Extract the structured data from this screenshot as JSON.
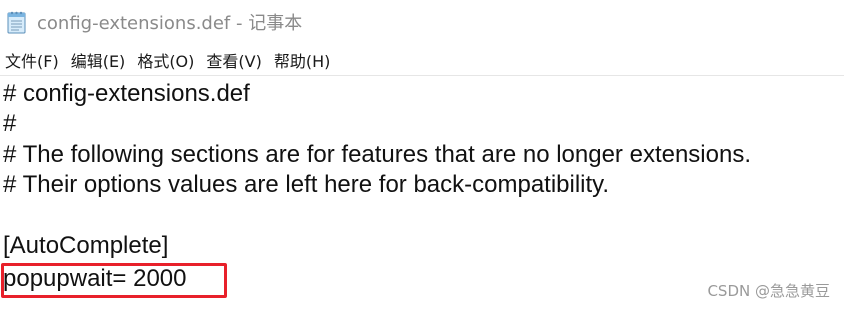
{
  "window": {
    "title": "config-extensions.def - 记事本",
    "icon": "notepad-icon"
  },
  "menu": {
    "items": [
      {
        "label": "文件(F)"
      },
      {
        "label": "编辑(E)"
      },
      {
        "label": "格式(O)"
      },
      {
        "label": "查看(V)"
      },
      {
        "label": "帮助(H)"
      }
    ]
  },
  "editor": {
    "lines": [
      "# config-extensions.def",
      "#",
      "# The following sections are for features that are no longer extensions.",
      "# Their options values are left here for back-compatibility.",
      "",
      "[AutoComplete]",
      "popupwait= 2000"
    ],
    "highlight_color": "#e8202a"
  },
  "watermark": {
    "text": "CSDN @急急黄豆"
  }
}
